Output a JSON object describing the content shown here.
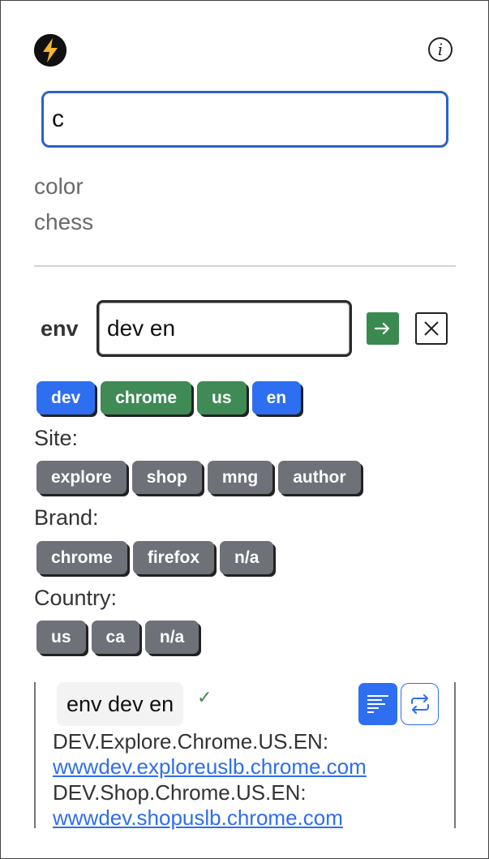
{
  "header": {
    "logo_icon": "lightning-bolt-icon",
    "info_icon": "info-icon",
    "info_glyph": "i"
  },
  "search": {
    "value": "c",
    "suggestions": [
      "color",
      "chess"
    ]
  },
  "env": {
    "label": "env",
    "input_value": "dev en",
    "go_icon": "arrow-right-icon",
    "clear_icon": "close-icon"
  },
  "active_tags": [
    {
      "label": "dev",
      "color": "#2e6ef0"
    },
    {
      "label": "chrome",
      "color": "#3f8a55"
    },
    {
      "label": "us",
      "color": "#3f8a55"
    },
    {
      "label": "en",
      "color": "#2e6ef0"
    }
  ],
  "groups": {
    "site": {
      "label": "Site:",
      "options": [
        "explore",
        "shop",
        "mng",
        "author"
      ]
    },
    "brand": {
      "label": "Brand:",
      "options": [
        "chrome",
        "firefox",
        "n/a"
      ]
    },
    "country": {
      "label": "Country:",
      "options": [
        "us",
        "ca",
        "n/a"
      ]
    }
  },
  "result": {
    "title": "env dev en",
    "status_icon": "checkmark-icon",
    "status_glyph": "✓",
    "format_icon": "format-lines-icon",
    "swap_icon": "swap-arrows-icon",
    "entries": [
      {
        "name": "DEV.Explore.Chrome.US.EN:",
        "url": "wwwdev.exploreuslb.chrome.com"
      },
      {
        "name": "DEV.Shop.Chrome.US.EN:",
        "url": "wwwdev.shopuslb.chrome.com"
      }
    ]
  },
  "colors": {
    "accent_blue": "#2e6ef0",
    "accent_green": "#3f8a55",
    "tag_gray": "#6e7178",
    "search_border": "#2b62c4"
  }
}
